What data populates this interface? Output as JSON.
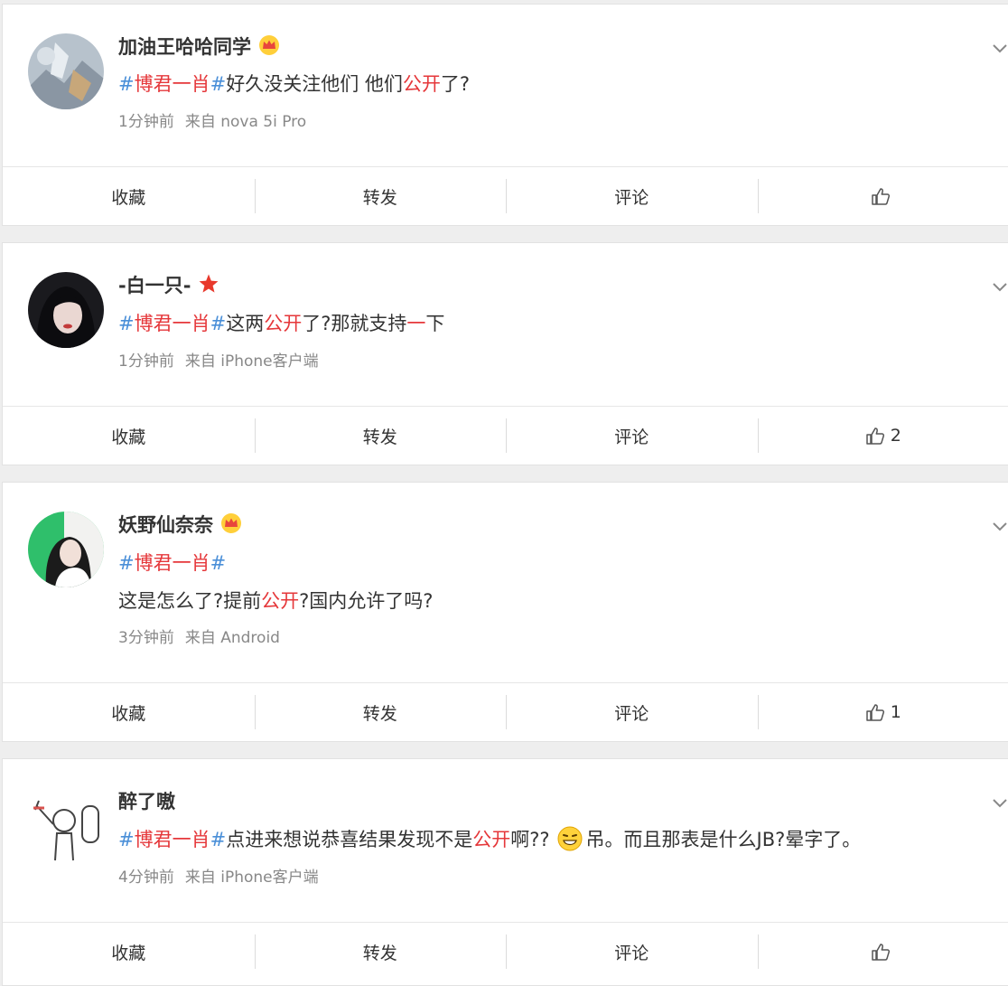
{
  "actions": {
    "collect": "收藏",
    "repost": "转发",
    "comment": "评论"
  },
  "posts": [
    {
      "username": "加油王哈哈同学",
      "badge": "crown-badge-icon",
      "tag_open": "#",
      "tag_name": "博君一肖",
      "tag_close": "#",
      "line1_before": "好久没关注他们 他们",
      "line1_kw": "公开",
      "line1_after": "了?",
      "time": "1分钟前",
      "source": "来自 nova 5i Pro",
      "likes": ""
    },
    {
      "username": "-白一只-",
      "badge": "star-badge-icon",
      "tag_open": "#",
      "tag_name": "博君一肖",
      "tag_close": "#",
      "line1_a": "这两",
      "line1_kw1": "公开",
      "line1_b": "了?那就支持",
      "line1_kw2": "一",
      "line1_c": "下",
      "time": "1分钟前",
      "source": "来自 iPhone客户端",
      "likes": "2"
    },
    {
      "username": "妖野仙奈奈",
      "badge": "crown-badge-icon",
      "tag_open": "#",
      "tag_name": "博君一肖",
      "tag_close": "#",
      "line2_before": "这是怎么了?提前",
      "line2_kw": "公开",
      "line2_after": "?国内允许了吗?",
      "time": "3分钟前",
      "source": "来自 Android",
      "likes": "1"
    },
    {
      "username": "醉了嗷",
      "tag_open": "#",
      "tag_name": "博君一肖",
      "tag_close": "#",
      "line1_before": "点进来想说恭喜结果发现不是",
      "line1_kw": "公开",
      "line1_mid": "啊??",
      "emoji": "grin-emoji-icon",
      "line1_after": "吊。而且那表是什么JB?晕字了。",
      "time": "4分钟前",
      "source": "来自 iPhone客户端",
      "likes": ""
    }
  ]
}
